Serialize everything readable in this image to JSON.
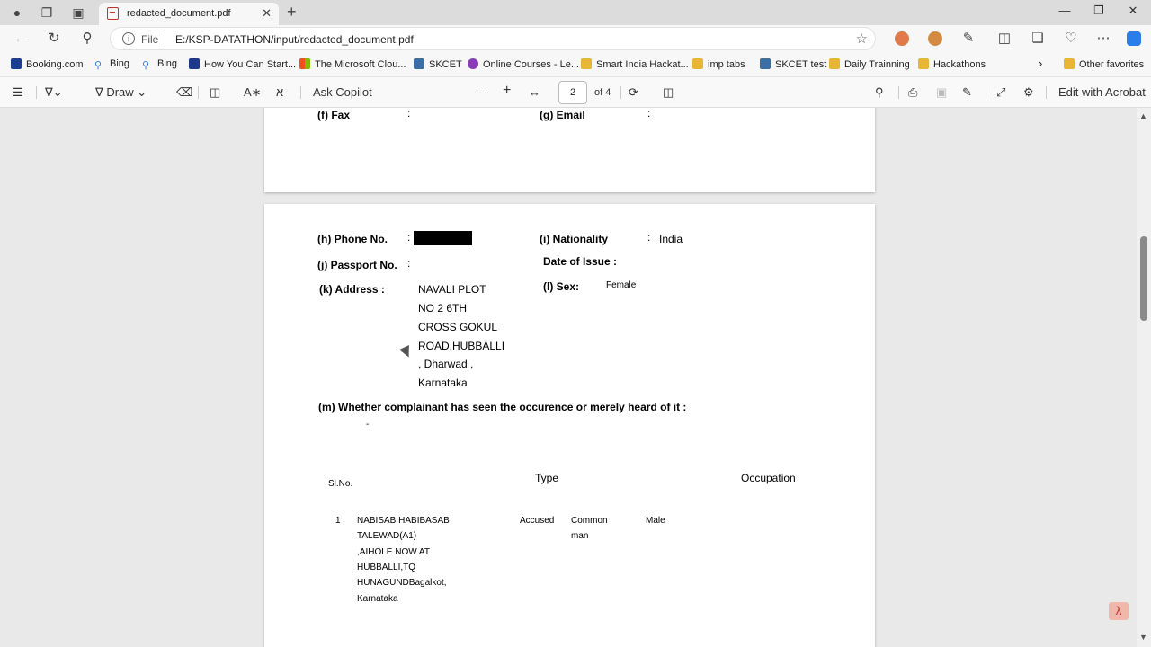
{
  "browser": {
    "tab_title": "redacted_document.pdf",
    "address_scheme": "File",
    "address_url": "E:/KSP-DATATHON/input/redacted_document.pdf",
    "bookmarks": [
      "Booking.com",
      "Bing",
      "Bing",
      "How You Can Start...",
      "The Microsoft Clou...",
      "SKCET",
      "Online Courses - Le...",
      "Smart India Hackat...",
      "imp tabs",
      "SKCET test",
      "Daily Trainning",
      "Hackathons"
    ],
    "other_favorites": "Other favorites"
  },
  "pdf_toolbar": {
    "draw": "Draw",
    "ask_copilot": "Ask Copilot",
    "page_current": "2",
    "page_total": "of 4",
    "edit_acrobat": "Edit with Acrobat"
  },
  "page1": {
    "fax_label": "(f) Fax",
    "fax_colon": ":",
    "email_label": "(g) Email",
    "email_colon": ":"
  },
  "page2": {
    "phone_label": "(h) Phone No.",
    "phone_colon": ":",
    "nationality_label": "(i)  Nationality",
    "nationality_colon": ":",
    "nationality_value": "India",
    "passport_label": "(j) Passport No.",
    "passport_colon": ":",
    "date_issue_label": "Date of Issue :",
    "address_label": "(k) Address :",
    "address_lines": [
      "NAVALI PLOT",
      "NO 2 6TH",
      "CROSS GOKUL",
      "ROAD,HUBBALLI",
      ", Dharwad ,",
      "Karnataka"
    ],
    "sex_label": "(l) Sex:",
    "sex_value": "Female",
    "complainant_question": "(m) Whether complainant has seen the occurence or merely heard of it :",
    "complainant_answer": "-",
    "table": {
      "headers": {
        "slno": "Sl.No.",
        "type": "Type",
        "occupation": "Occupation"
      },
      "row": {
        "num": "1",
        "name_lines": [
          "NABISAB HABIBASAB",
          "TALEWAD(A1)",
          ",AIHOLE NOW AT",
          "HUBBALLI,TQ",
          "HUNAGUNDBagalkot,",
          "Karnataka"
        ],
        "type": "Accused",
        "occupation_lines": [
          "Common",
          "man"
        ],
        "gender": "Male"
      }
    }
  }
}
